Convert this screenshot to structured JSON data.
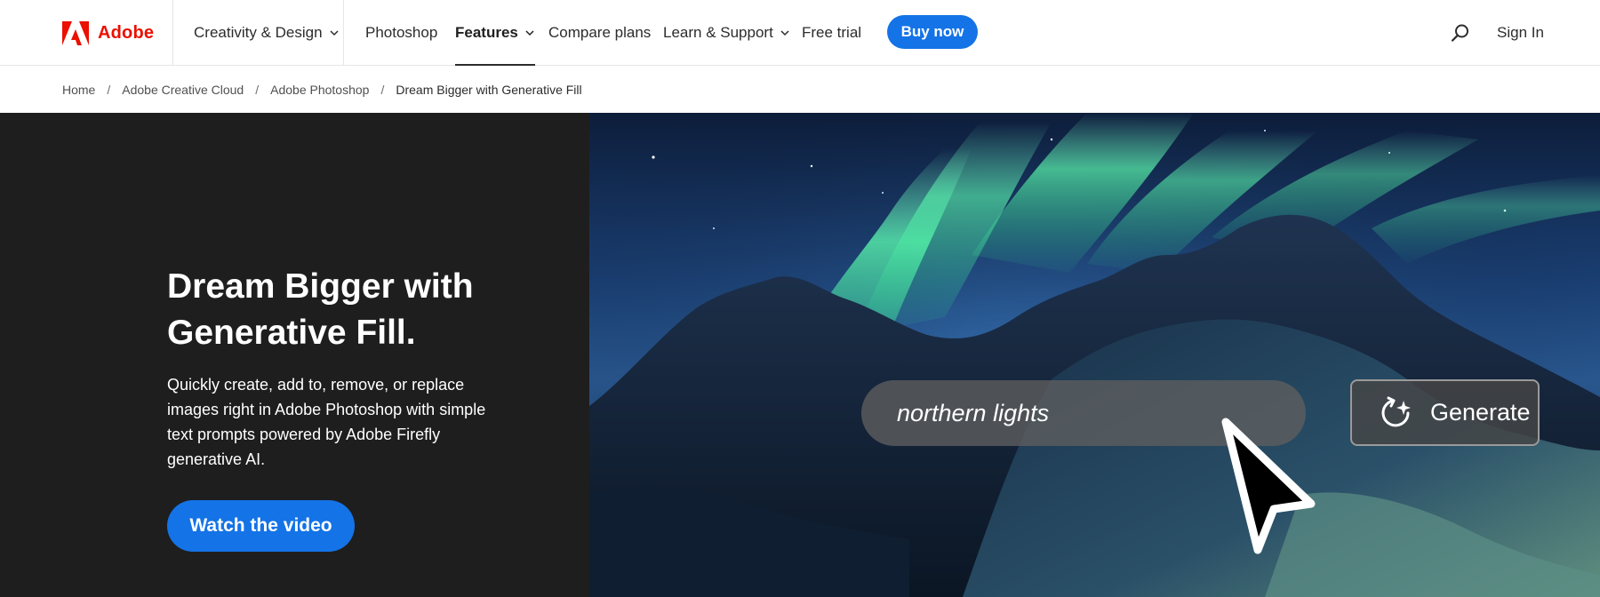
{
  "brand": {
    "name": "Adobe",
    "color": "#eb1000",
    "icon": "adobe-logo-icon"
  },
  "nav": {
    "items": [
      {
        "label": "Creativity & Design",
        "dropdown": true
      },
      {
        "label": "Photoshop",
        "dropdown": false
      },
      {
        "label": "Features",
        "dropdown": true,
        "active": true
      },
      {
        "label": "Compare plans",
        "dropdown": false
      },
      {
        "label": "Learn & Support",
        "dropdown": true
      },
      {
        "label": "Free trial",
        "dropdown": false
      }
    ],
    "buy_label": "Buy now",
    "sign_in_label": "Sign In",
    "search_icon": "search-icon",
    "accent": "#1473e6"
  },
  "breadcrumb": {
    "items": [
      "Home",
      "Adobe Creative Cloud",
      "Adobe Photoshop",
      "Dream Bigger with Generative Fill"
    ],
    "separator": "/"
  },
  "hero": {
    "title": "Dream Bigger with Generative Fill.",
    "description": "Quickly create, add to, remove, or replace images right in Adobe Photoshop with simple text prompts powered by Adobe Firefly generative AI.",
    "cta_label": "Watch the video",
    "image": {
      "prompt_text": "northern lights",
      "generate_label": "Generate",
      "generate_icon": "generate-sparkle-icon",
      "cursor_icon": "mouse-pointer-icon"
    }
  }
}
